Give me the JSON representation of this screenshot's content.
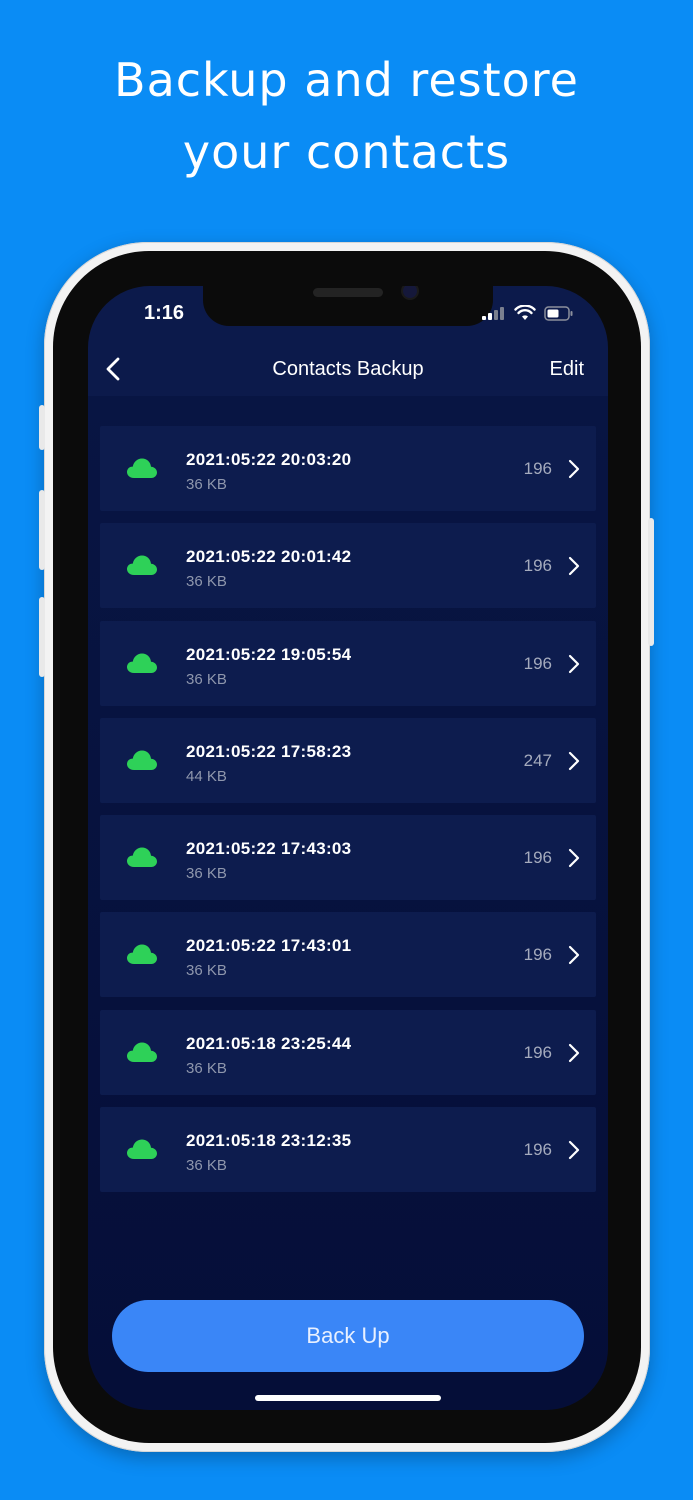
{
  "headline": {
    "line1": "Backup and restore",
    "line2": "your contacts"
  },
  "status_bar": {
    "time": "1:16",
    "icons": [
      "signal-icon",
      "wifi-icon",
      "battery-icon"
    ]
  },
  "nav": {
    "back_icon": "chevron-left-icon",
    "title": "Contacts Backup",
    "edit_label": "Edit"
  },
  "backups": [
    {
      "date": "2021:05:22 20:03:20",
      "size": "36 KB",
      "count": "196"
    },
    {
      "date": "2021:05:22 20:01:42",
      "size": "36 KB",
      "count": "196"
    },
    {
      "date": "2021:05:22 19:05:54",
      "size": "36 KB",
      "count": "196"
    },
    {
      "date": "2021:05:22 17:58:23",
      "size": "44 KB",
      "count": "247"
    },
    {
      "date": "2021:05:22 17:43:03",
      "size": "36 KB",
      "count": "196"
    },
    {
      "date": "2021:05:22 17:43:01",
      "size": "36 KB",
      "count": "196"
    },
    {
      "date": "2021:05:18 23:25:44",
      "size": "36 KB",
      "count": "196"
    },
    {
      "date": "2021:05:18 23:12:35",
      "size": "36 KB",
      "count": "196"
    }
  ],
  "backup_button": {
    "label": "Back Up"
  },
  "colors": {
    "background": "#0a8cf5",
    "screen": "#081543",
    "row": "#0d1c4e",
    "cloud": "#2ed158",
    "button": "#3a86f7"
  }
}
